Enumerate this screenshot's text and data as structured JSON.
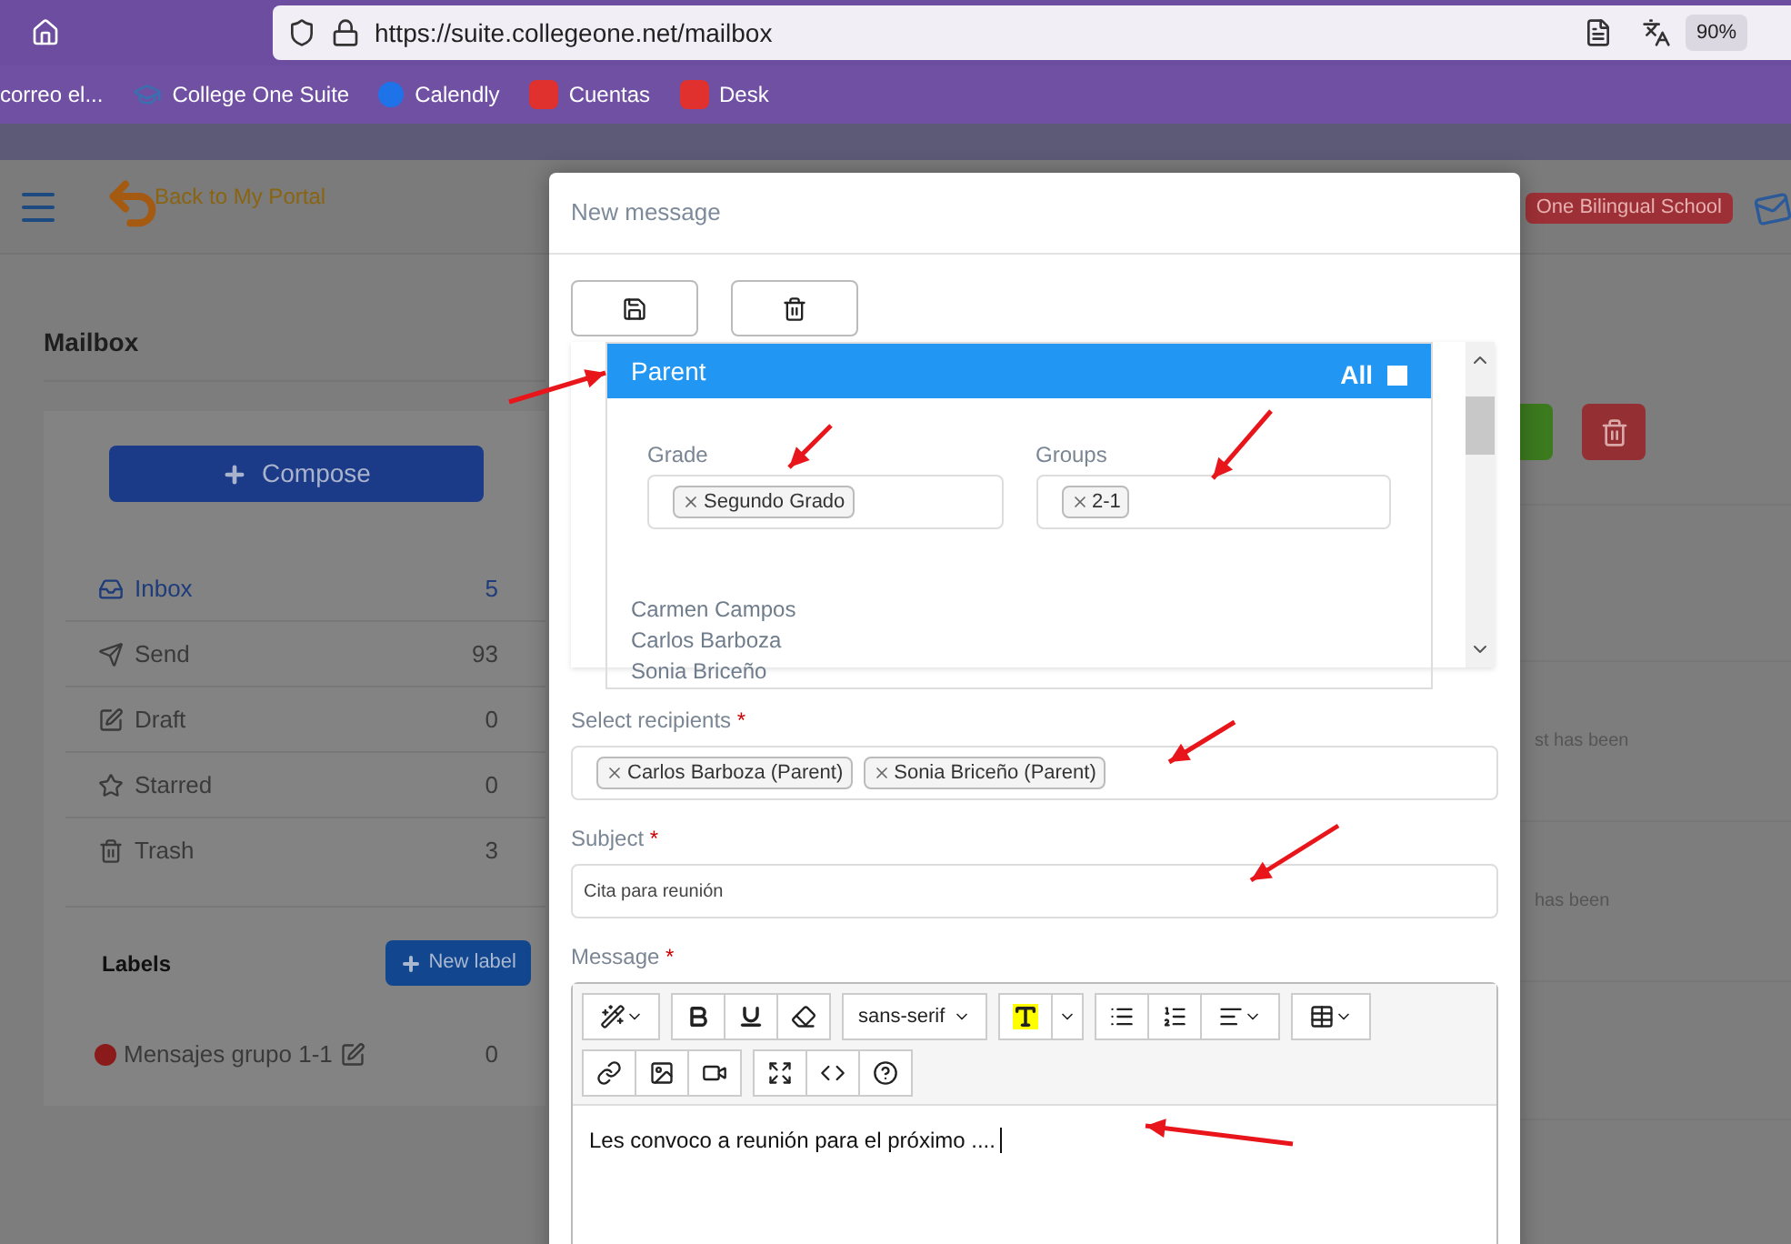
{
  "browser": {
    "url": "https://suite.collegeone.net/mailbox",
    "zoom": "90%",
    "bookmarks": [
      {
        "label": "correo el...",
        "kind": "plain"
      },
      {
        "label": "College One Suite",
        "kind": "hat"
      },
      {
        "label": "Calendly",
        "kind": "circle"
      },
      {
        "label": "Cuentas",
        "kind": "square"
      },
      {
        "label": "Desk",
        "kind": "square"
      }
    ]
  },
  "app_header": {
    "back_link": "Back to My Portal",
    "school_badge": "One Bilingual School"
  },
  "mailbox": {
    "title": "Mailbox",
    "compose": "Compose",
    "folders": [
      {
        "name": "Inbox",
        "count": "5",
        "kind": "inbox",
        "selected": true
      },
      {
        "name": "Send",
        "count": "93",
        "kind": "send",
        "selected": false
      },
      {
        "name": "Draft",
        "count": "0",
        "kind": "draft",
        "selected": false
      },
      {
        "name": "Starred",
        "count": "0",
        "kind": "starred",
        "selected": false
      },
      {
        "name": "Trash",
        "count": "3",
        "kind": "trash",
        "selected": false
      }
    ],
    "labels_title": "Labels",
    "new_label": "New label",
    "labels": [
      {
        "name": "Mensajes grupo 1-1",
        "count": "0",
        "color": "#8b1a1a"
      }
    ]
  },
  "message_snippets": [
    "st has been",
    "has been"
  ],
  "modal": {
    "title": "New message",
    "required_mark": "*",
    "group": {
      "name": "Parent",
      "all_label": "All",
      "all_checked": false,
      "grade_label": "Grade",
      "grade_tags": [
        "Segundo Grado"
      ],
      "groups_label": "Groups",
      "group_tags": [
        "2-1"
      ],
      "people": [
        "Carmen Campos",
        "Carlos Barboza",
        "Sonia Briceño"
      ]
    },
    "recipients_label": "Select recipients",
    "recipients": [
      "Carlos Barboza (Parent)",
      "Sonia Briceño (Parent)"
    ],
    "subject_label": "Subject",
    "subject_value": "Cita para reunión",
    "message_label": "Message",
    "font": "sans-serif",
    "body": "Les convoco a reunión para el próximo ...."
  }
}
